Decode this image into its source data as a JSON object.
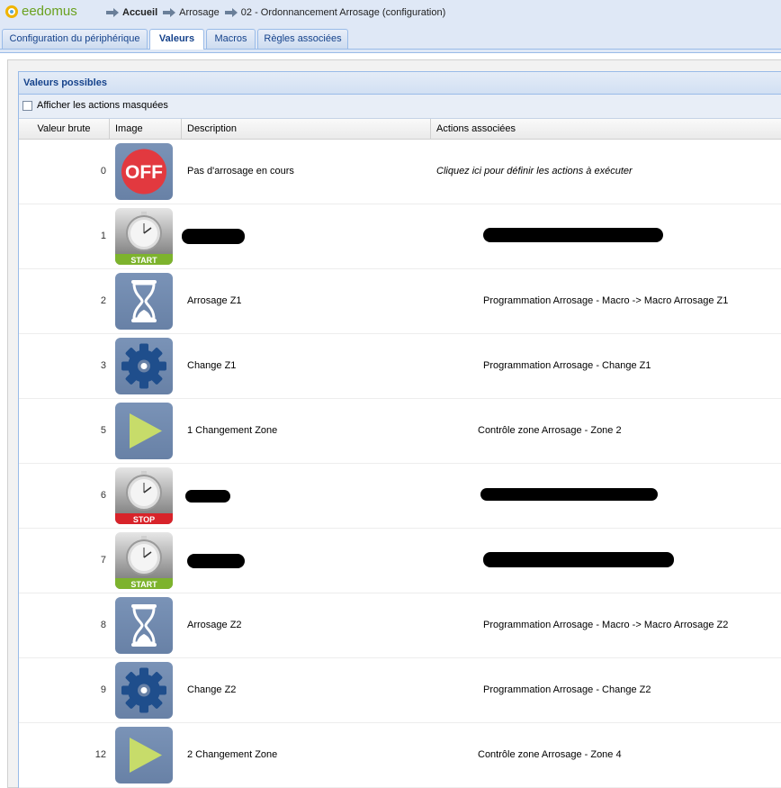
{
  "header": {
    "logo_text": "eedomus",
    "breadcrumb": {
      "home": "Accueil",
      "level1": "Arrosage",
      "level2": "02 - Ordonnancement Arrosage (configuration)"
    }
  },
  "tabs": [
    {
      "label": "Configuration du périphérique",
      "active": false
    },
    {
      "label": "Valeurs",
      "active": true
    },
    {
      "label": "Macros",
      "active": false
    },
    {
      "label": "Règles associées",
      "active": false
    }
  ],
  "panel": {
    "title": "Valeurs possibles",
    "show_hidden_label": "Afficher les actions masquées"
  },
  "columns": {
    "raw_value": "Valeur brute",
    "image": "Image",
    "description": "Description",
    "actions": "Actions associées"
  },
  "rows": [
    {
      "value": "0",
      "icon": "off-icon",
      "description": "Pas d'arrosage en cours",
      "action": "Cliquez ici pour définir les actions à exécuter"
    },
    {
      "value": "1",
      "icon": "stopwatch-start-icon",
      "description": "",
      "action": ""
    },
    {
      "value": "2",
      "icon": "hourglass-icon",
      "description": "Arrosage Z1",
      "action": "Programmation Arrosage - Macro -> Macro Arrosage Z1"
    },
    {
      "value": "3",
      "icon": "gear-icon",
      "description": "Change Z1",
      "action": "Programmation Arrosage - Change Z1"
    },
    {
      "value": "5",
      "icon": "play-icon",
      "description": "1 Changement Zone",
      "action": "Contrôle zone Arrosage - Zone 2"
    },
    {
      "value": "6",
      "icon": "stopwatch-stop-icon",
      "description": "",
      "action": ""
    },
    {
      "value": "7",
      "icon": "stopwatch-start-icon",
      "description": "",
      "action": ""
    },
    {
      "value": "8",
      "icon": "hourglass-icon",
      "description": "Arrosage Z2",
      "action": "Programmation Arrosage - Macro -> Macro Arrosage Z2"
    },
    {
      "value": "9",
      "icon": "gear-icon",
      "description": "Change Z2",
      "action": "Programmation Arrosage - Change Z2"
    },
    {
      "value": "12",
      "icon": "play-icon",
      "description": "2 Changement Zone",
      "action": "Contrôle zone Arrosage - Zone 4"
    }
  ],
  "icon_labels": {
    "off": "OFF",
    "start": "START",
    "stop": "STOP"
  },
  "colors": {
    "accent": "#15428b",
    "off_red": "#e2393f",
    "icon_blue": "#6f88ad",
    "gear_blue": "#1f4e8c",
    "play_green": "#c7dc6a",
    "start_green": "#7db32d",
    "stop_red": "#d8232a"
  }
}
